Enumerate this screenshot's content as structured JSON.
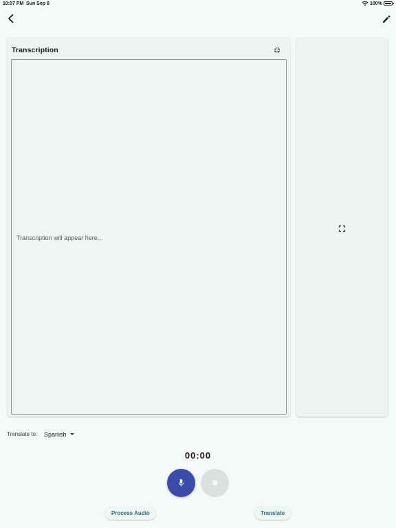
{
  "status_bar": {
    "time": "10:07 PM",
    "date": "Sun Sep 8",
    "battery": "100%"
  },
  "icons": {
    "back": "chevron-left-icon",
    "edit": "pencil-icon",
    "collapse": "fullscreen-exit-icon",
    "expand": "fullscreen-icon",
    "mic": "microphone-icon",
    "stop": "stop-icon"
  },
  "transcription": {
    "title": "Transcription",
    "placeholder": "Transcription will appear here..."
  },
  "translate": {
    "label": "Translate to:",
    "selected_language": "Spanish"
  },
  "recorder": {
    "timer": "00:00"
  },
  "actions": {
    "process_label": "Process Audio",
    "translate_label": "Translate"
  },
  "colors": {
    "background": "#f5f9fa",
    "panel": "#eef4f4",
    "record": "#3a4ba8",
    "stop": "#dcdfe0",
    "accent_text": "#2e6e74"
  }
}
